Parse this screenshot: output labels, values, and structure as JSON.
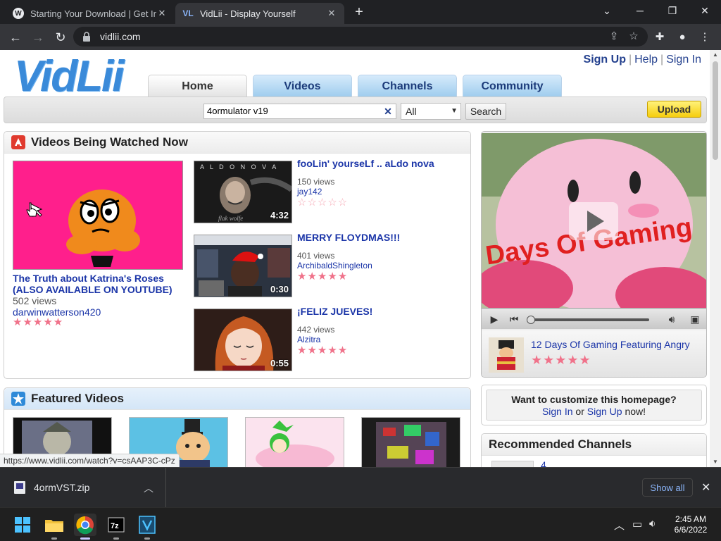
{
  "browser": {
    "tabs": [
      {
        "title": "Starting Your Download | Get Inte",
        "active": false
      },
      {
        "title": "VidLii - Display Yourself",
        "active": true
      }
    ],
    "new_tab": "+",
    "url": "vidlii.com",
    "status_url": "https://www.vidlii.com/watch?v=csAAP3C-cPz"
  },
  "site": {
    "logo": "VidLii",
    "top_links": [
      "Sign Up",
      "Help",
      "Sign In"
    ],
    "nav_tabs": [
      "Home",
      "Videos",
      "Channels",
      "Community"
    ],
    "search": {
      "value": "4ormulator v19",
      "category": "All",
      "button": "Search"
    },
    "upload": "Upload"
  },
  "watched": {
    "heading": "Videos Being Watched Now",
    "featured_video": {
      "title": "The Truth about Katrina's Roses (ALSO AVAILABLE ON YOUTUBE)",
      "views": "502 views",
      "user": "darwinwatterson420",
      "rating": 5
    },
    "videos": [
      {
        "title": "fooLin' yourseLf .. aLdo nova",
        "views": "150 views",
        "user": "jay142",
        "duration": "4:32",
        "rating": 0,
        "thumb_text": "A L D O  N O V A"
      },
      {
        "title": "MERRY FLOYDMAS!!!",
        "views": "401 views",
        "user": "ArchibaldShingleton",
        "duration": "0:30",
        "rating": 5
      },
      {
        "title": "¡FELIZ JUEVES!",
        "views": "442 views",
        "user": "Alzitra",
        "duration": "0:55",
        "rating": 5
      }
    ]
  },
  "featured": {
    "heading": "Featured Videos"
  },
  "player": {
    "overlay_text": "Days Of Gaming",
    "now_playing": "12 Days Of Gaming Featuring Angry",
    "rating": 5
  },
  "customize": {
    "question": "Want to customize this homepage?",
    "sign_in": "Sign In",
    "or": "or",
    "sign_up": "Sign Up",
    "now": "now!"
  },
  "recommended": {
    "heading": "Recommended Channels",
    "partial_item": "4"
  },
  "download": {
    "file": "4ormVST.zip",
    "show_all": "Show all"
  },
  "taskbar": {
    "time": "2:45 AM",
    "date": "6/6/2022"
  },
  "colors": {
    "link": "#1b35a8",
    "nav_tab": "#9fcdee",
    "upload": "#f6cd0e",
    "star": "#f0728a"
  }
}
